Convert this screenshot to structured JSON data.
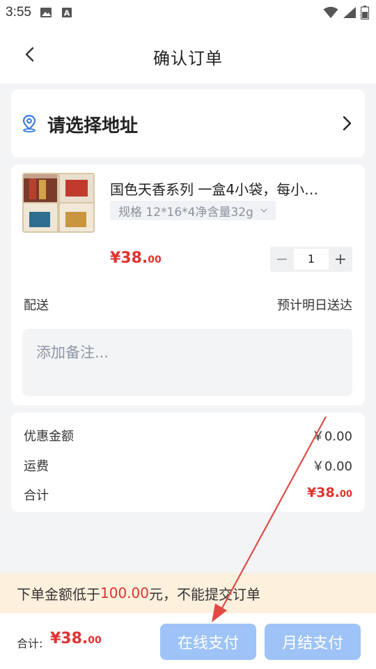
{
  "status_bar": {
    "time": "3:55",
    "icons": [
      "image-icon",
      "font-a-icon",
      "wifi-icon",
      "signal-icon",
      "battery-icon"
    ]
  },
  "nav": {
    "back_icon": "chevron-left-icon",
    "title": "确认订单"
  },
  "address": {
    "pin_icon": "location-pin-icon",
    "text": "请选择地址",
    "chevron_icon": "chevron-right-icon"
  },
  "product": {
    "title": "国色天香系列 一盒4小袋，每小…",
    "spec": "规格 12*16*4净含量32g",
    "spec_icon": "chevron-down-icon",
    "price_int": "¥38.",
    "price_dec": "00",
    "quantity": "1",
    "minus": "−",
    "plus": "+"
  },
  "delivery": {
    "label": "配送",
    "value": "预计明日送达"
  },
  "note": {
    "placeholder": "添加备注..."
  },
  "summary": {
    "discount_label": "优惠金额",
    "discount_value": "￥0.00",
    "shipping_label": "运费",
    "shipping_value": "￥0.00",
    "total_label": "合计",
    "total_int": "¥38.",
    "total_dec": "00"
  },
  "warning": {
    "prefix": "下单金额低于",
    "amount": "100.00",
    "suffix": "元，不能提交订单"
  },
  "bottom": {
    "total_label": "合计:",
    "total_int": "¥38.",
    "total_dec": "00",
    "pay_online": "在线支付",
    "pay_monthly": "月结支付"
  },
  "colors": {
    "accent_red": "#e0322f",
    "button_blue_disabled": "#9ec3f7",
    "pin_blue": "#3b7ddd",
    "warning_bg": "#fdf0dd",
    "annotation_arrow": "#e04b44"
  }
}
